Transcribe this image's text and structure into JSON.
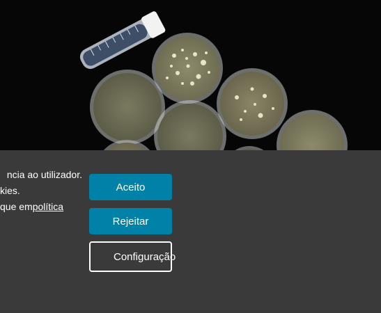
{
  "hero": {
    "image_alt": "petri-dishes-photo"
  },
  "banner": {
    "text_lines": [
      "ncia ao utilizador.",
      "kies.",
      "que em "
    ],
    "policy_link": "política"
  },
  "buttons": {
    "accept": "Aceito",
    "reject": "Rejeitar",
    "settings": "Configuração"
  },
  "colors": {
    "banner_bg": "#3a3a3a",
    "button_blue": "#0082a8",
    "photo_bg": "#060606"
  }
}
